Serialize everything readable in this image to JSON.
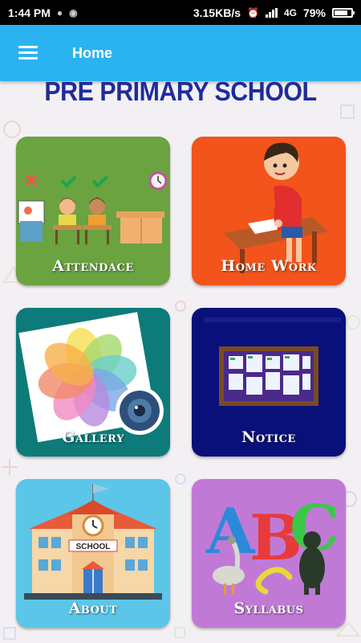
{
  "status_bar": {
    "time": "1:44 PM",
    "speed": "3.15KB/s",
    "network": "4G",
    "battery": "79%"
  },
  "app_bar": {
    "title": "Home",
    "menu_icon": "hamburger-menu-icon"
  },
  "school_name": "PRE PRIMARY SCHOOL",
  "tiles": [
    {
      "label": "Attendace",
      "icon": "classroom-attendance-icon",
      "color": "#6aa33f"
    },
    {
      "label": "Home Work",
      "icon": "boy-writing-icon",
      "color": "#f2541b"
    },
    {
      "label": "Gallery",
      "icon": "photos-pinwheel-icon",
      "color": "#0d7b7a"
    },
    {
      "label": "Notice",
      "icon": "notice-board-icon",
      "color": "#0a107a"
    },
    {
      "label": "About",
      "icon": "school-building-icon",
      "color": "#5cc6e8"
    },
    {
      "label": "Syllabus",
      "icon": "abc-letters-icon",
      "color": "#c07ad6"
    }
  ],
  "colors": {
    "app_bar": "#2bb2f0",
    "title": "#1f2c9c"
  }
}
